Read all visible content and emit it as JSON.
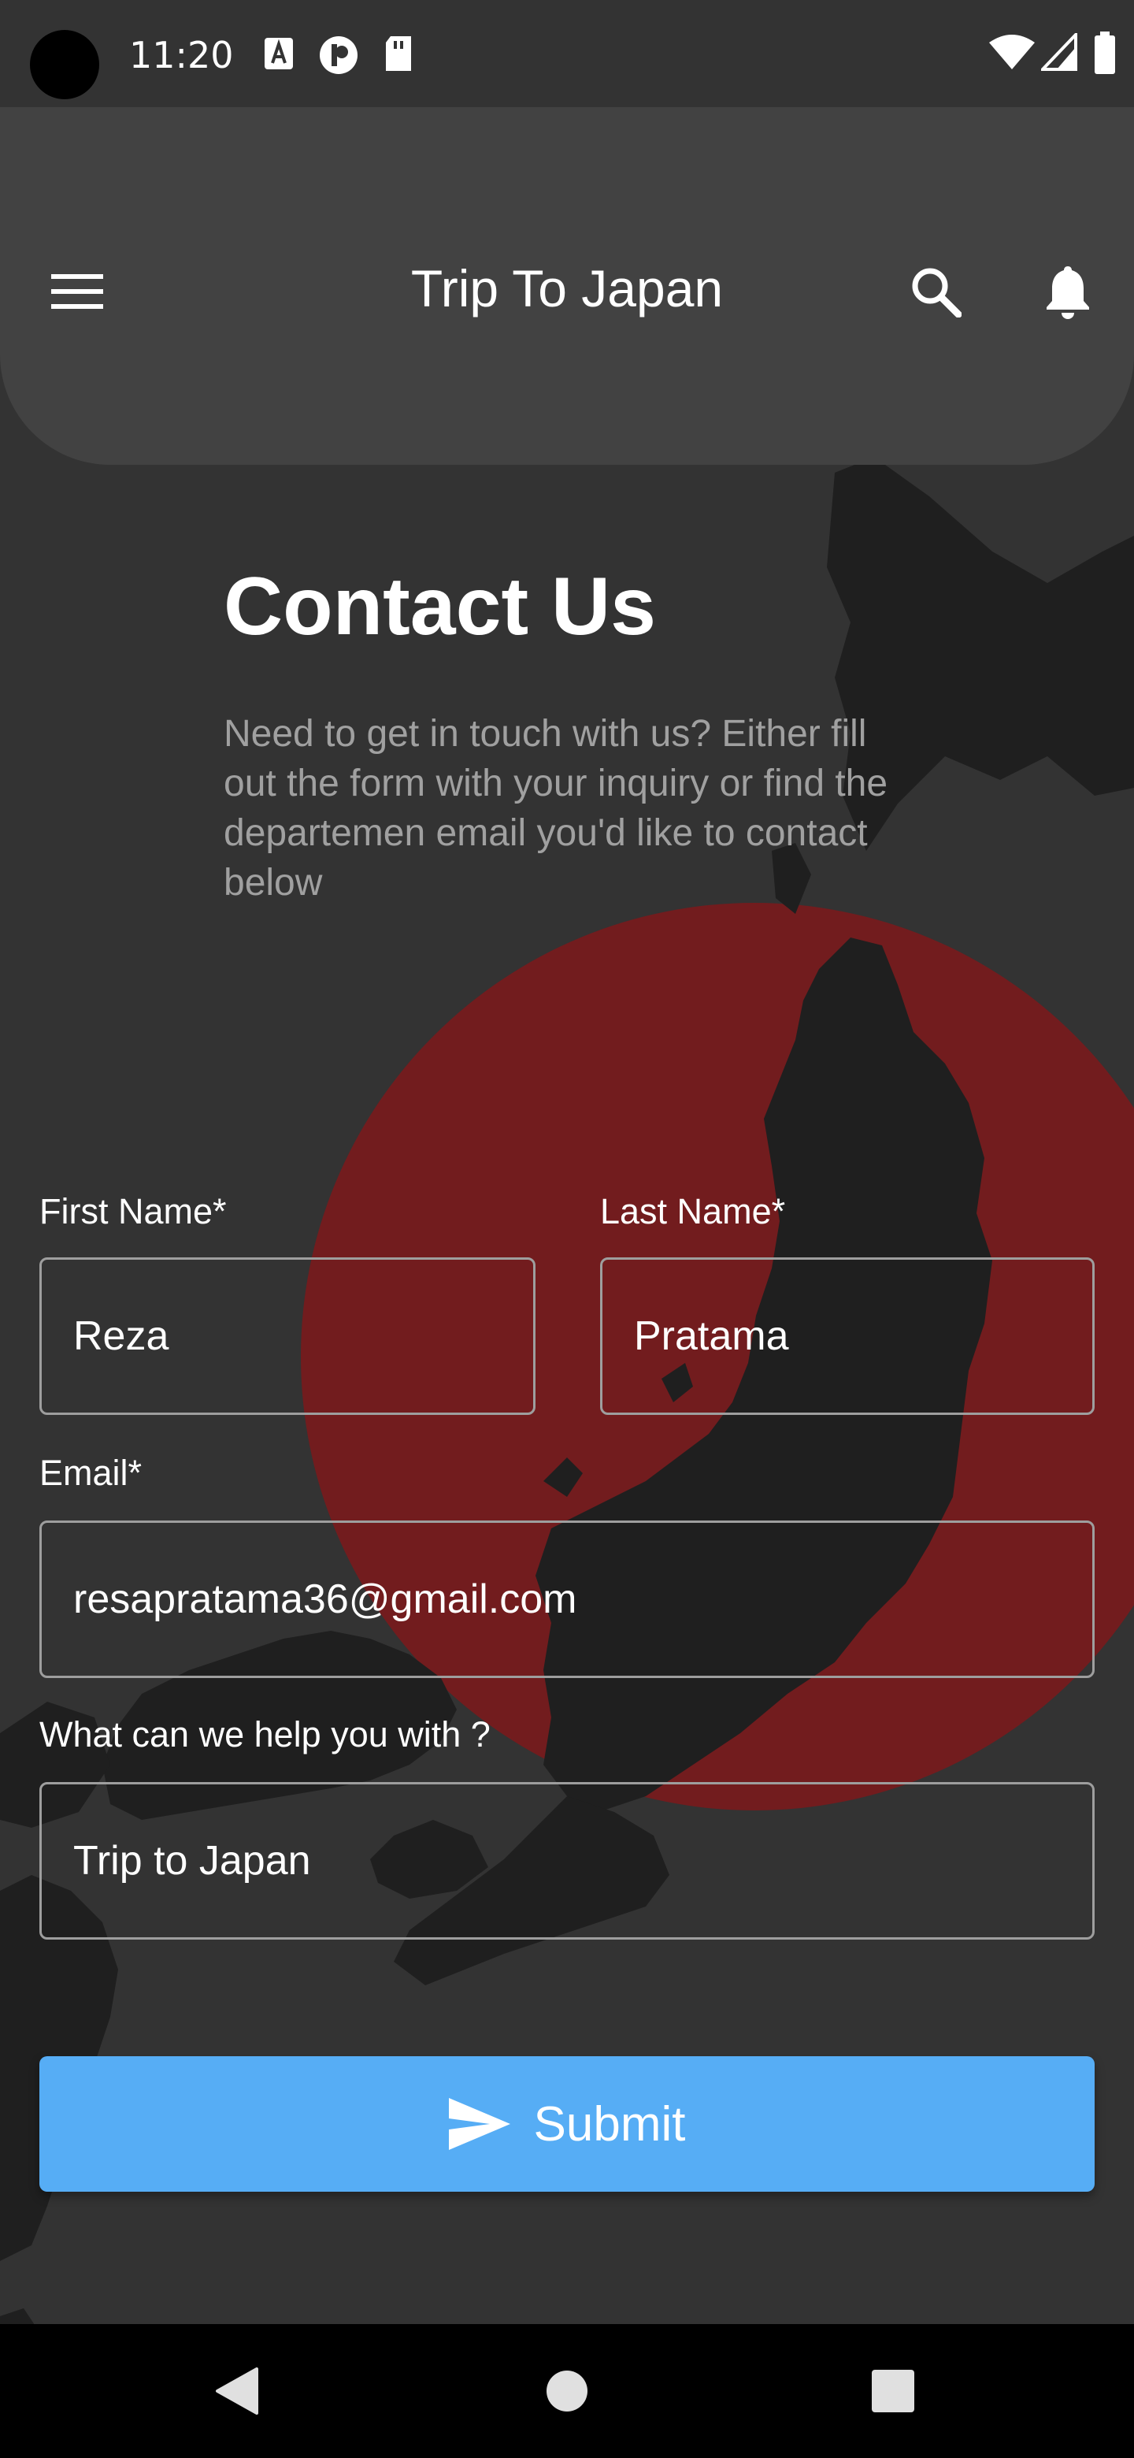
{
  "status_bar": {
    "time": "11:20"
  },
  "app_bar": {
    "title": "Trip To Japan"
  },
  "page": {
    "heading": "Contact Us",
    "intro": "Need to get in touch with us? Either fill out the form with your inquiry or find the departemen email you'd like to contact below"
  },
  "form": {
    "first_name": {
      "label": "First Name*",
      "value": "Reza"
    },
    "last_name": {
      "label": "Last Name*",
      "value": "Pratama"
    },
    "email": {
      "label": "Email*",
      "value": "resapratama36@gmail.com"
    },
    "help": {
      "label": "What can we help you with ?",
      "value": "Trip to Japan"
    },
    "submit_label": "Submit"
  },
  "colors": {
    "background": "#333333",
    "app_bar": "#424242",
    "accent": "#56adf5",
    "sun": "#721c1e",
    "map": "#1f1f1f"
  },
  "icons": {
    "menu": "menu-icon",
    "search": "search-icon",
    "notifications": "bell-icon",
    "submit": "send-icon",
    "back": "back-triangle-icon",
    "home": "home-circle-icon",
    "recents": "recents-square-icon"
  }
}
